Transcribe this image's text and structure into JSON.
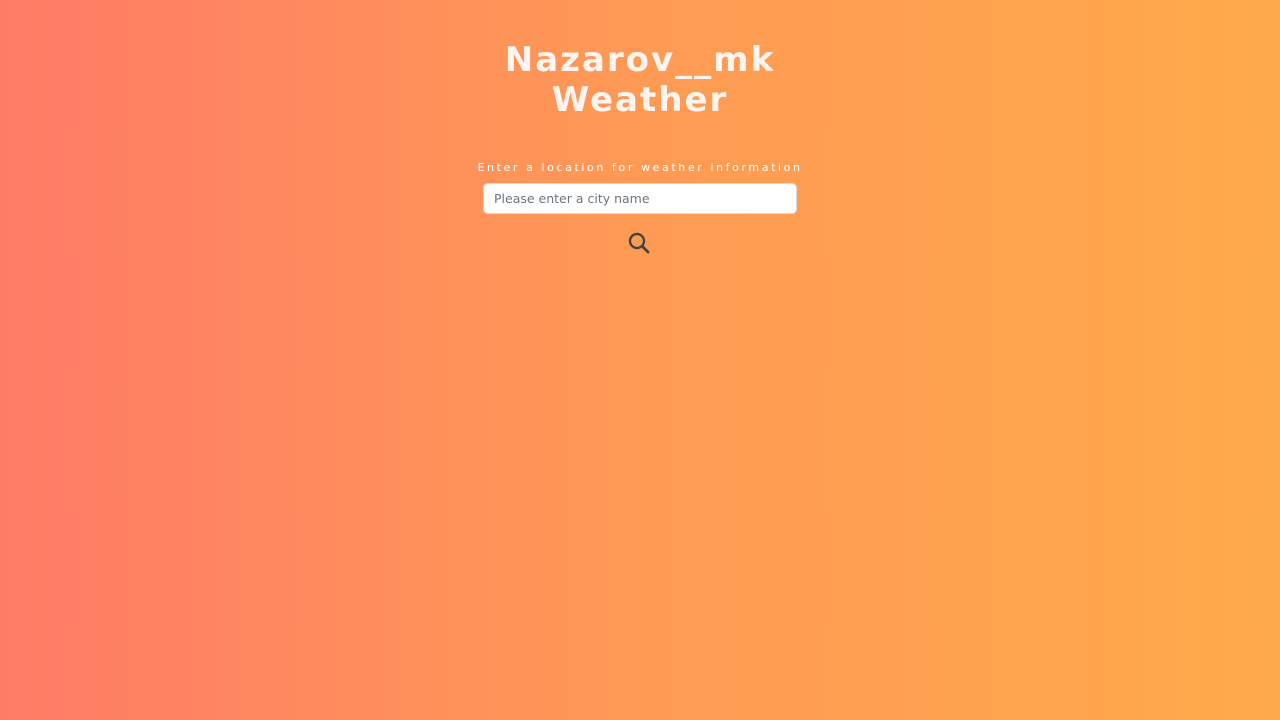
{
  "header": {
    "title_line1": "Nazarov__mk",
    "title_line2": "Weather"
  },
  "search": {
    "prompt": "Enter a location for weather information",
    "placeholder": "Please enter a city name",
    "value": "",
    "button_icon": "search-icon"
  },
  "colors": {
    "gradient_left": "#ff7b66",
    "gradient_right": "#ffaa4a",
    "title": "#fff4ee",
    "icon": "#444444"
  }
}
